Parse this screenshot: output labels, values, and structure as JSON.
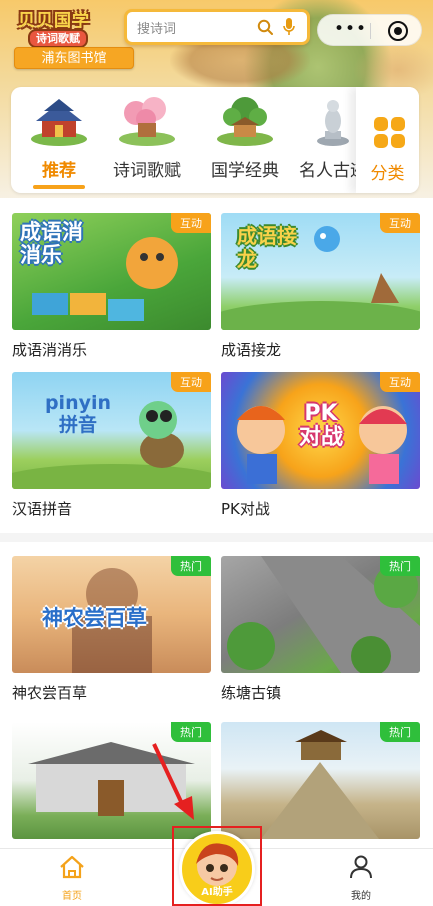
{
  "header": {
    "logo_line1": "贝贝国学",
    "logo_line2": "诗词歌赋",
    "library": "浦东图书馆",
    "search_placeholder": "搜诗词",
    "capsule_more": "•••"
  },
  "categories": [
    {
      "label": "推荐",
      "active": true
    },
    {
      "label": "诗词歌赋",
      "active": false
    },
    {
      "label": "国学经典",
      "active": false
    },
    {
      "label": "名人古迹",
      "active": false
    }
  ],
  "more_category": "分类",
  "games": [
    {
      "title": "成语消消乐",
      "badge": "互动",
      "art": "成语消消乐"
    },
    {
      "title": "成语接龙",
      "badge": "互动",
      "art": "成语接龙"
    },
    {
      "title": "汉语拼音",
      "badge": "互动",
      "art": "pinyin 拼音"
    },
    {
      "title": "PK对战",
      "badge": "互动",
      "art": "PK 对战"
    }
  ],
  "hot": [
    {
      "title": "神农尝百草",
      "badge": "热门",
      "art": "神农尝百草"
    },
    {
      "title": "练塘古镇",
      "badge": "热门"
    },
    {
      "title": "",
      "badge": "热门"
    },
    {
      "title": "",
      "badge": "热门"
    }
  ],
  "tabbar": {
    "home": "首页",
    "ai": "AI助手",
    "mine": "我的"
  },
  "colors": {
    "accent": "#f7a21a",
    "badge_orange": "#f7a21a",
    "badge_green": "#2fbf3b",
    "highlight": "#e52020"
  }
}
